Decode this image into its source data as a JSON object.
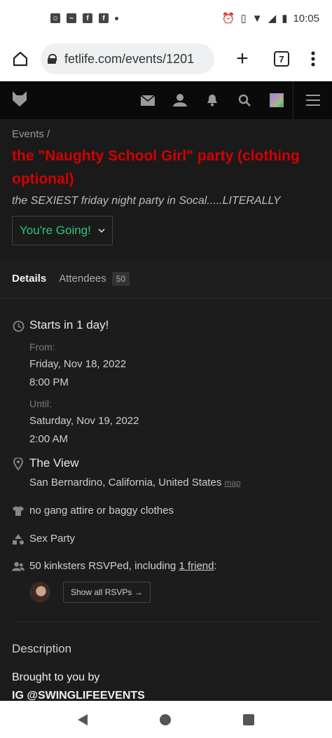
{
  "status_bar": {
    "time": "10:05"
  },
  "browser": {
    "url": "fetlife.com/events/1201",
    "tab_count": "7"
  },
  "event": {
    "breadcrumb": "Events /",
    "title": "the \"Naughty School Girl\" party (clothing optional)",
    "subtitle": "the SEXIEST friday night party in Socal.....LITERALLY",
    "rsvp_button": "You're Going!"
  },
  "tabs": {
    "details": "Details",
    "attendees": "Attendees",
    "attendees_count": "50"
  },
  "details": {
    "starts": "Starts in 1 day!",
    "from_label": "From:",
    "from_date": "Friday, Nov 18, 2022",
    "from_time": "8:00 PM",
    "until_label": "Until:",
    "until_date": "Saturday, Nov 19, 2022",
    "until_time": "2:00 AM",
    "venue": "The View",
    "location": "San Bernardino, California, United States",
    "map_link": "map",
    "dress_code": "no gang attire or baggy clothes",
    "category": "Sex Party",
    "rsvp_prefix": "50 kinksters RSVPed, including ",
    "rsvp_friend": "1 friend",
    "rsvp_suffix": ":",
    "show_all": "Show all RSVPs →"
  },
  "description": {
    "heading": "Description",
    "line1": "Brought to you by",
    "line2": "IG @SWINGLIFEEVENTS"
  },
  "colors": {
    "title_red": "#d40000",
    "going_green": "#2ec37a",
    "background": "#1c1c1c"
  }
}
